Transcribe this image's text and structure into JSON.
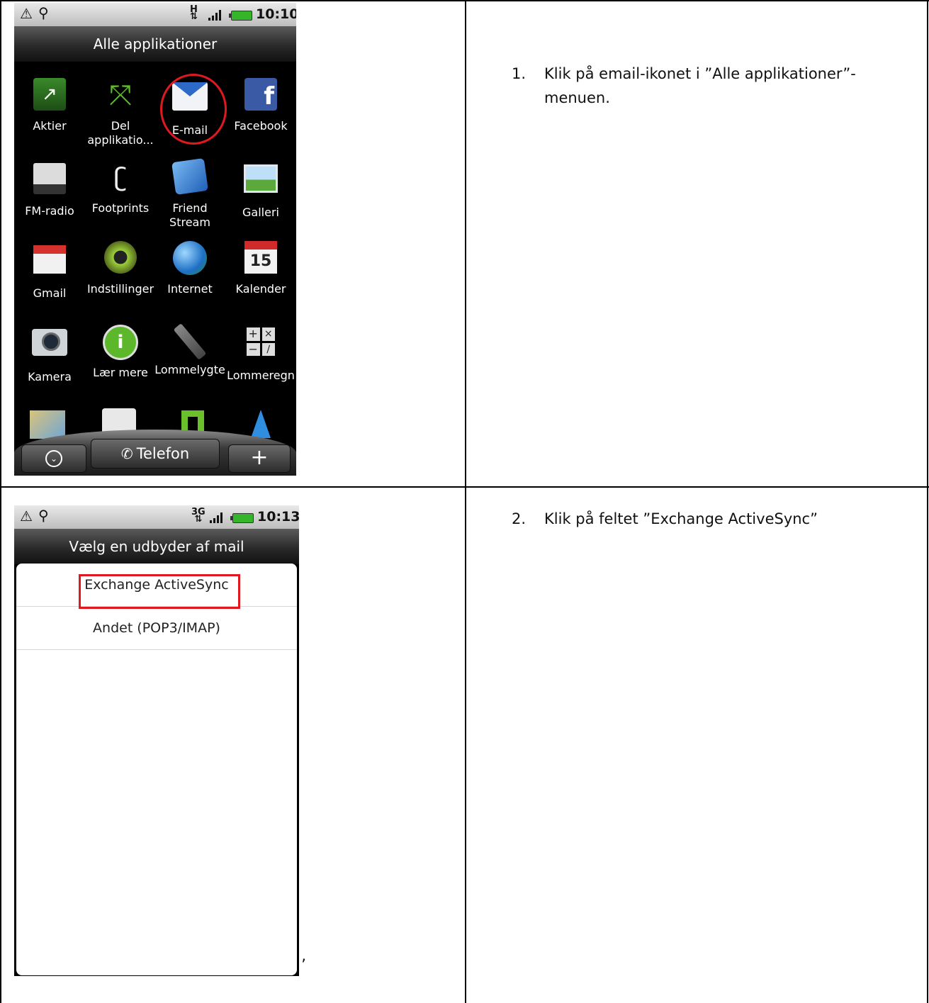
{
  "rows": [
    {
      "phone": {
        "status": {
          "network": "H",
          "time": "10:10"
        },
        "title": "Alle applikationer",
        "apps": [
          {
            "label": "Aktier",
            "icon": "stocks-icon"
          },
          {
            "label": "Del\napplikatio...",
            "icon": "share-apps-icon"
          },
          {
            "label": "E-mail",
            "icon": "email-icon",
            "highlighted": true
          },
          {
            "label": "Facebook",
            "icon": "facebook-icon"
          },
          {
            "label": "FM-radio",
            "icon": "fm-radio-icon"
          },
          {
            "label": "Footprints",
            "icon": "footprints-icon"
          },
          {
            "label": "Friend\nStream",
            "icon": "friend-stream-icon"
          },
          {
            "label": "Galleri",
            "icon": "gallery-icon"
          },
          {
            "label": "Gmail",
            "icon": "gmail-icon"
          },
          {
            "label": "Indstillinger",
            "icon": "settings-gear-icon"
          },
          {
            "label": "Internet",
            "icon": "globe-icon"
          },
          {
            "label": "Kalender",
            "icon": "calendar-icon",
            "calendar_day": "15"
          },
          {
            "label": "Kamera",
            "icon": "camera-icon"
          },
          {
            "label": "Lær mere",
            "icon": "info-icon"
          },
          {
            "label": "Lommelygte",
            "icon": "flashlight-icon"
          },
          {
            "label": "Lommeregn",
            "icon": "calculator-icon"
          }
        ],
        "dock": {
          "phone_label": "Telefon"
        }
      },
      "instruction": {
        "number": "1.",
        "text": "Klik på email-ikonet i ”Alle applikationer”-menuen."
      }
    },
    {
      "phone": {
        "status": {
          "network": "3G",
          "time": "10:13"
        },
        "title": "Vælg en udbyder af mail",
        "options": [
          "Exchange ActiveSync",
          "Andet (POP3/IMAP)"
        ],
        "highlighted_option": "Exchange ActiveSync"
      },
      "trailing_mark": "’",
      "instruction": {
        "number": "2.",
        "text": "Klik på feltet ”Exchange ActiveSync”"
      }
    }
  ],
  "colors": {
    "highlight_red": "#e0181f",
    "dark_bg": "#000000",
    "battery_green": "#35b52a"
  }
}
